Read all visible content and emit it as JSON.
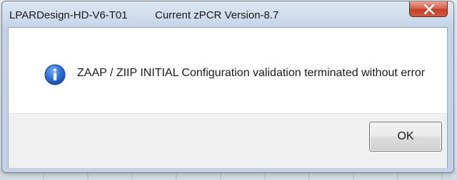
{
  "window": {
    "title": "LPARDesign-HD-V6-T01",
    "version_text": "Current zPCR Version-8.7",
    "close_icon": "close-icon"
  },
  "dialog": {
    "icon": "info-icon",
    "message": "ZAAP / ZIIP INITIAL Configuration validation terminated without error"
  },
  "buttons": {
    "ok_label": "OK"
  },
  "colors": {
    "close_button": "#c4412a",
    "info_icon": "#1f5fbf",
    "title_bar": "#c3d2e6"
  }
}
